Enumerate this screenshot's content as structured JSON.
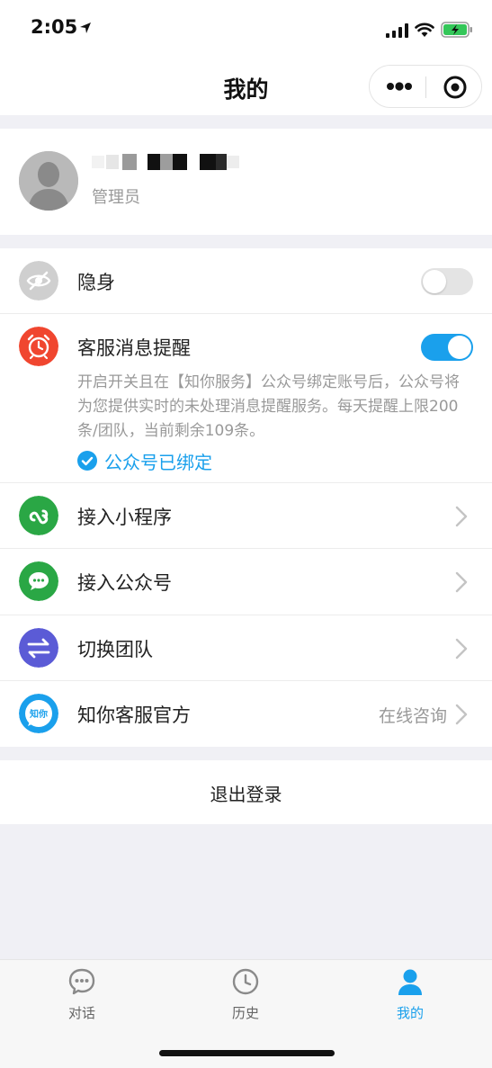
{
  "status": {
    "time": "2:05"
  },
  "nav": {
    "title": "我的"
  },
  "profile": {
    "role": "管理员"
  },
  "settings": {
    "invisible": {
      "label": "隐身",
      "enabled": false
    },
    "reminder": {
      "label": "客服消息提醒",
      "enabled": true,
      "description": "开启开关且在【知你服务】公众号绑定账号后，公众号将为您提供实时的未处理消息提醒服务。每天提醒上限200条/团队，当前剩余109条。",
      "bound_label": "公众号已绑定"
    },
    "miniprogram": {
      "label": "接入小程序"
    },
    "official": {
      "label": "接入公众号"
    },
    "switch_team": {
      "label": "切换团队"
    },
    "official_service": {
      "label": "知你客服官方",
      "extra": "在线咨询",
      "logo_text": "知你"
    }
  },
  "logout": {
    "label": "退出登录"
  },
  "tabs": [
    {
      "label": "对话",
      "icon": "chat-bubble-icon",
      "active": false
    },
    {
      "label": "历史",
      "icon": "clock-icon",
      "active": false
    },
    {
      "label": "我的",
      "icon": "person-icon",
      "active": true
    }
  ],
  "colors": {
    "accent": "#1aa0ec",
    "invisible_icon": "#cfcfcf",
    "reminder_icon": "#f0462f",
    "miniprogram_icon": "#2aa745",
    "official_icon": "#2aa745",
    "switch_icon": "#5b5bd6",
    "service_icon": "#1aa0ec"
  }
}
